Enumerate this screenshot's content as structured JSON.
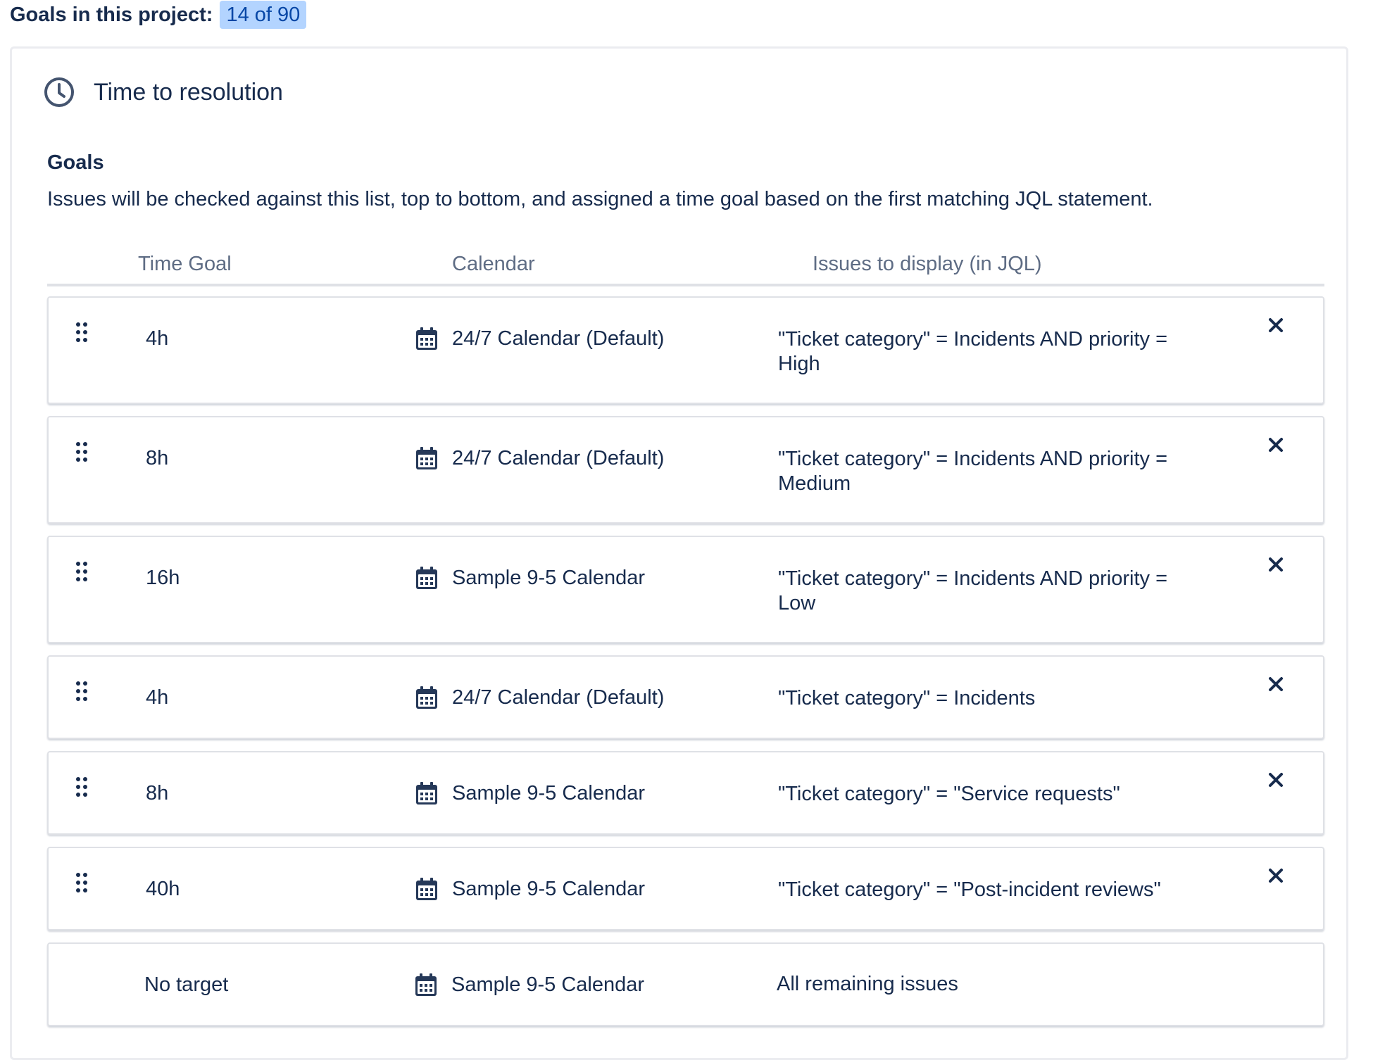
{
  "project_goals": {
    "label": "Goals in this project:",
    "count": "14 of 90"
  },
  "section": {
    "title": "Time to resolution",
    "icon": "clock-icon"
  },
  "goals": {
    "heading": "Goals",
    "description": "Issues will be checked against this list, top to bottom, and assigned a time goal based on the first matching JQL statement."
  },
  "table": {
    "headers": {
      "time_goal": "Time Goal",
      "calendar": "Calendar",
      "jql": "Issues to display (in JQL)"
    },
    "rows": [
      {
        "goal": "4h",
        "calendar": "24/7 Calendar (Default)",
        "jql": "\"Ticket category\" = Incidents AND priority = High"
      },
      {
        "goal": "8h",
        "calendar": "24/7 Calendar (Default)",
        "jql": "\"Ticket category\" = Incidents AND priority = Medium"
      },
      {
        "goal": "16h",
        "calendar": "Sample 9-5 Calendar",
        "jql": "\"Ticket category\" = Incidents AND priority = Low"
      },
      {
        "goal": "4h",
        "calendar": "24/7 Calendar (Default)",
        "jql": "\"Ticket category\" = Incidents"
      },
      {
        "goal": "8h",
        "calendar": "Sample 9-5 Calendar",
        "jql": "\"Ticket category\" = \"Service requests\""
      },
      {
        "goal": "40h",
        "calendar": "Sample 9-5 Calendar",
        "jql": "\"Ticket category\" = \"Post-incident reviews\""
      },
      {
        "goal": "No target",
        "calendar": "Sample 9-5 Calendar",
        "jql": "All remaining issues"
      }
    ]
  },
  "colors": {
    "text": "#172b4d",
    "subtle": "#5e6c84",
    "lozenge_bg": "#b3d4ff",
    "lozenge_text": "#0747a6",
    "border": "#dfe1e6"
  }
}
